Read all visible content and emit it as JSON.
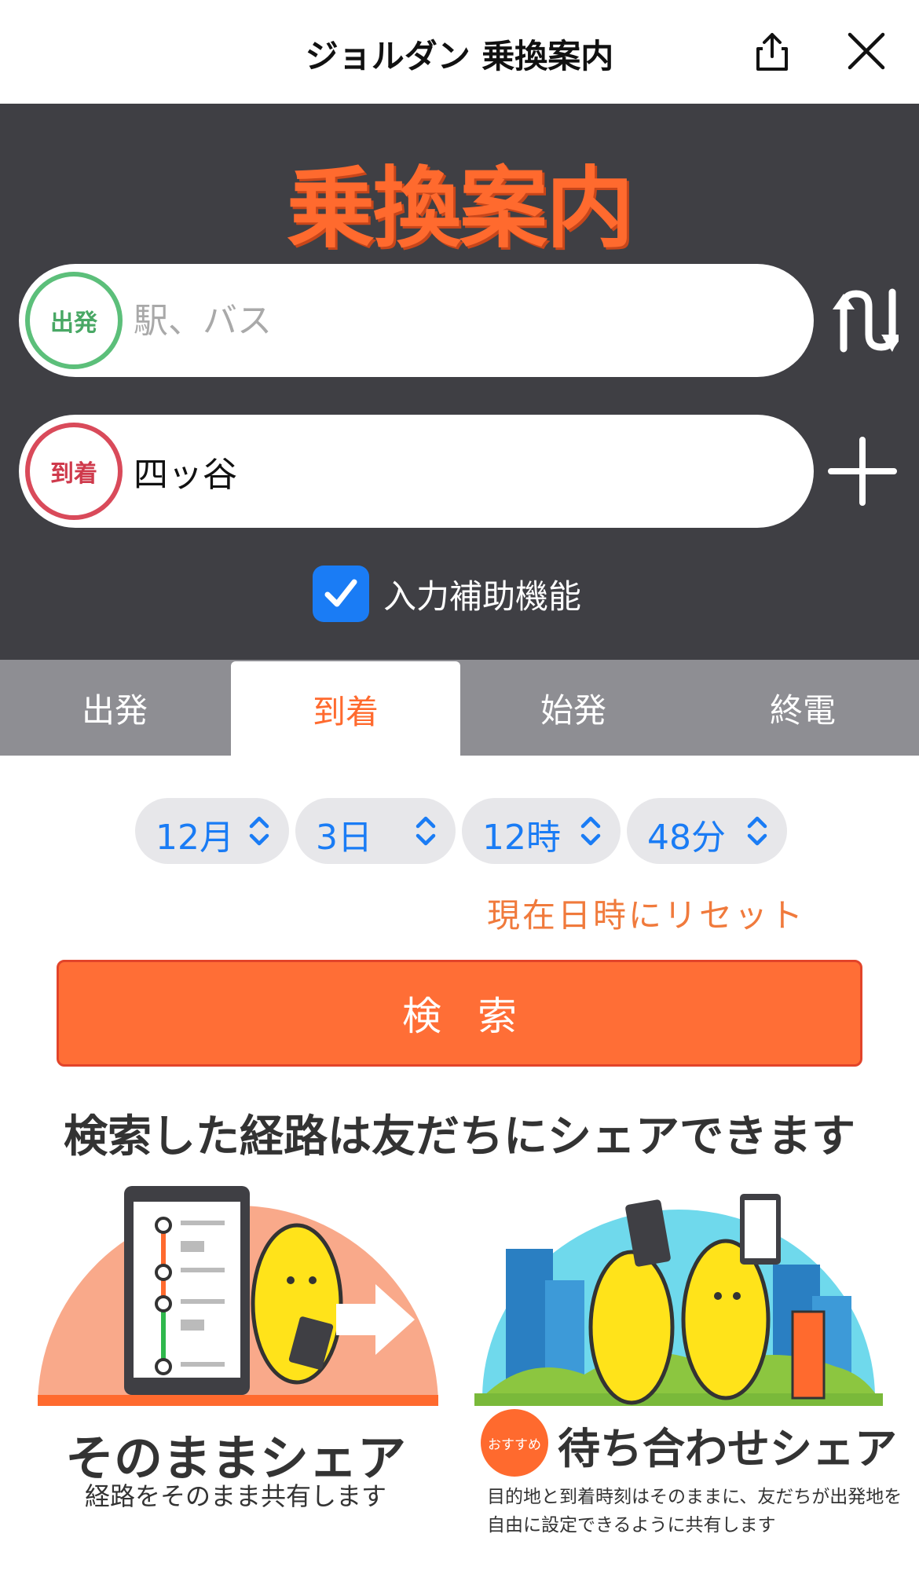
{
  "header": {
    "title": "ジョルダン 乗換案内",
    "icons": [
      "share-icon",
      "close-icon"
    ]
  },
  "logo": {
    "text": "乗換案内"
  },
  "departure": {
    "badge": "出発",
    "placeholder": "駅、バス",
    "value": ""
  },
  "arrival": {
    "badge": "到着",
    "value": "四ッ谷"
  },
  "assist": {
    "label": "入力補助機能",
    "checked": true
  },
  "tabs": [
    {
      "label": "出発",
      "active": false
    },
    {
      "label": "到着",
      "active": true
    },
    {
      "label": "始発",
      "active": false
    },
    {
      "label": "終電",
      "active": false
    }
  ],
  "datetime": {
    "month": "12月",
    "day": "3日",
    "hour": "12時",
    "minute": "48分"
  },
  "reset_label": "現在日時にリセット",
  "search_label": "検索",
  "share": {
    "title": "検索した経路は友だちにシェアできます",
    "card1": {
      "title": "そのままシェア",
      "subtitle": "経路をそのまま共有します"
    },
    "card2": {
      "badge": "おすすめ",
      "title": "待ち合わせシェア",
      "description": "目的地と到着時刻はそのままに、友だちが出発地を自由に設定できるように共有します"
    }
  },
  "colors": {
    "accent": "#ff6a2e",
    "panel": "#3f3f44",
    "departure": "#5cbf7a",
    "arrival": "#d94a5a",
    "link": "#1a7cf5"
  }
}
